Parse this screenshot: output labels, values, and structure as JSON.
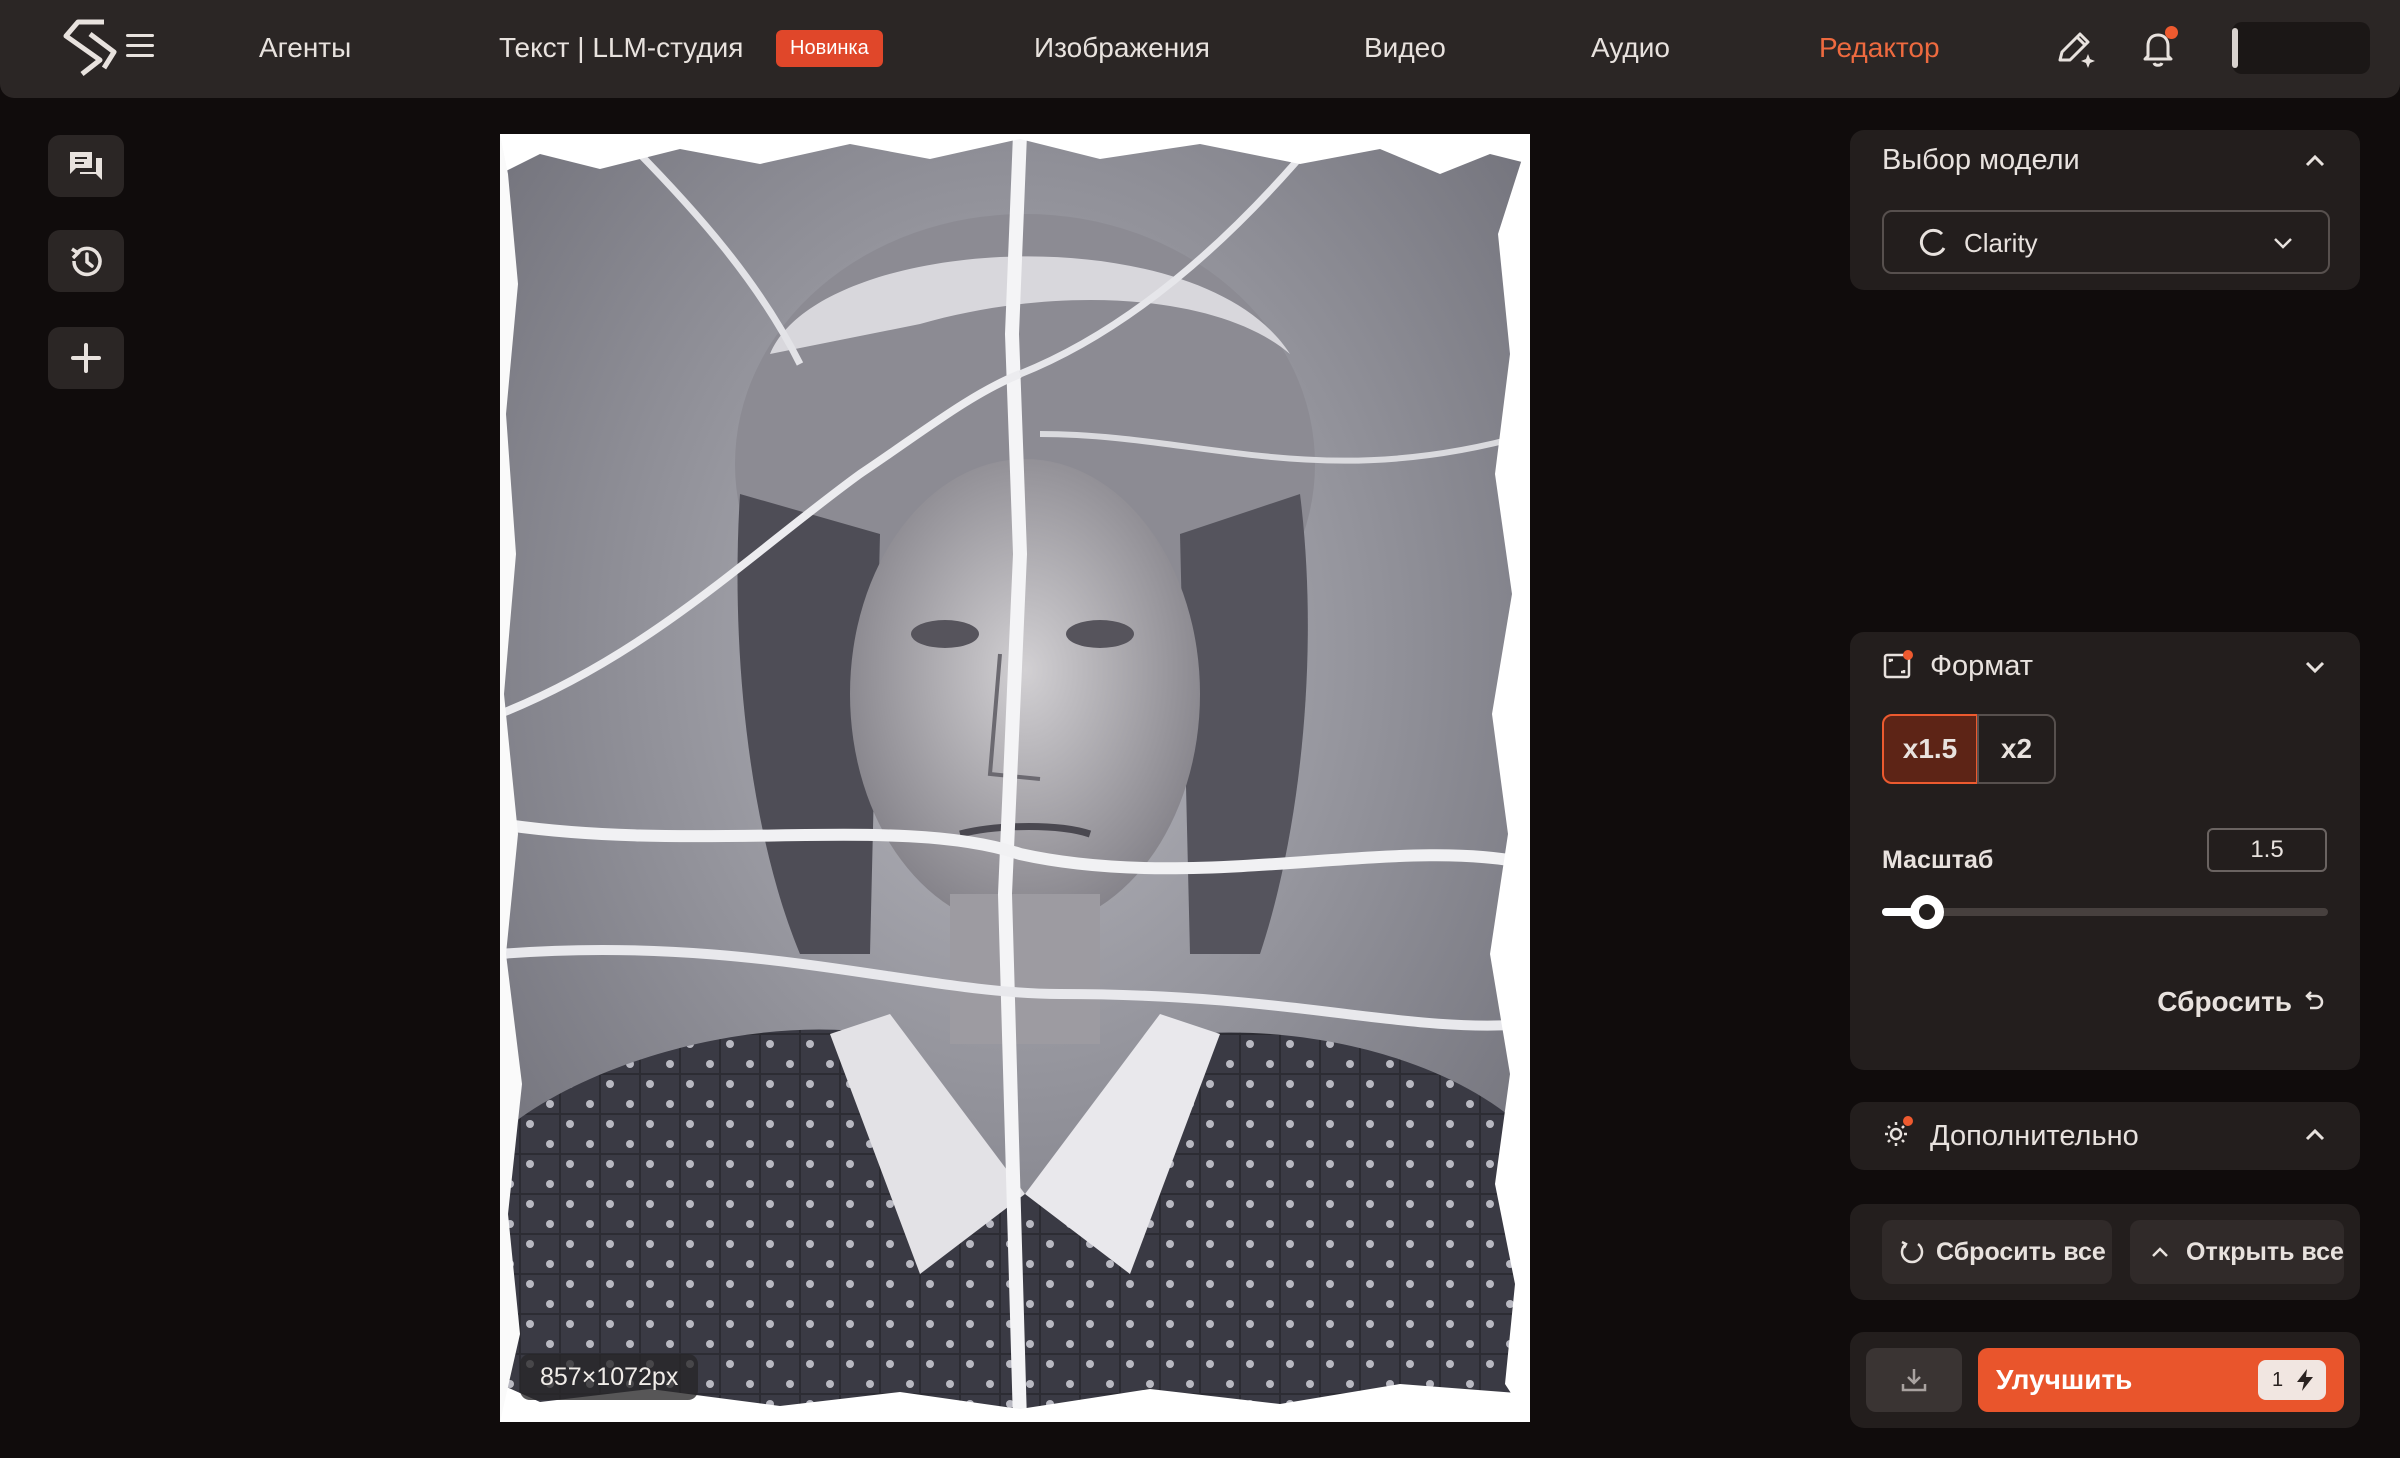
{
  "header": {
    "nav": {
      "agents": "Агенты",
      "text_studio": "Текст | LLM-студия",
      "new_badge": "Новинка",
      "images": "Изображения",
      "video": "Видео",
      "audio": "Аудио",
      "editor": "Редактор"
    },
    "active_item": "Редактор",
    "icons": [
      "logo-icon",
      "menu-icon",
      "pen-sparkle-icon",
      "bell-icon"
    ],
    "accent_color": "#ee6a3f"
  },
  "sidebar": {
    "tools": [
      "chat-icon",
      "history-icon",
      "plus-icon"
    ]
  },
  "canvas": {
    "image_size_label": "857×1072px"
  },
  "panel": {
    "model": {
      "title": "Выбор модели",
      "selected": "Clarity"
    },
    "format": {
      "title": "Формат",
      "options": [
        "x1.5",
        "x2"
      ],
      "selected": "x1.5",
      "scale_label": "Масштаб",
      "scale_value": "1.5",
      "slider_fraction": 0.1,
      "reset_label": "Сбросить"
    },
    "advanced": {
      "title": "Дополнительно"
    },
    "actions": {
      "reset_all": "Сбросить все",
      "open_all": "Открыть все",
      "enhance": "Улучшить",
      "cost": "1"
    }
  }
}
